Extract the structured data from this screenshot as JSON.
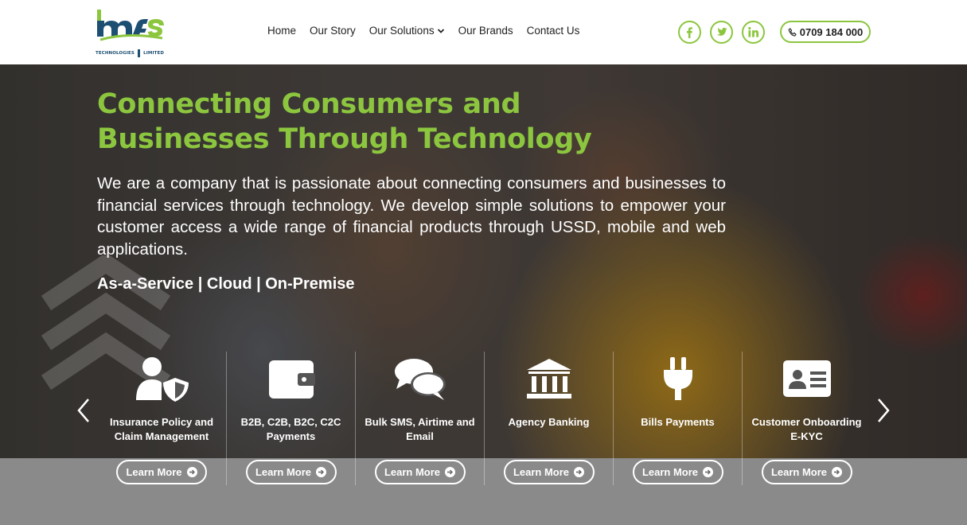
{
  "brand": {
    "logo_text": "mfs",
    "logo_subtext_1": "TECHNOLOGIES",
    "logo_subtext_2": "LIMITED",
    "accent_color": "#8cc63f",
    "dark_color": "#1d4f73"
  },
  "nav": {
    "items": [
      {
        "label": "Home"
      },
      {
        "label": "Our Story"
      },
      {
        "label": "Our Solutions",
        "has_dropdown": true
      },
      {
        "label": "Our Brands"
      },
      {
        "label": "Contact Us"
      }
    ]
  },
  "socials": [
    {
      "icon": "facebook-icon"
    },
    {
      "icon": "twitter-icon"
    },
    {
      "icon": "linkedin-icon"
    }
  ],
  "phone": {
    "icon": "phone-icon",
    "number": "0709 184 000"
  },
  "hero": {
    "title": "Connecting Consumers and Businesses Through Technology",
    "text": "We are a company that is passionate about connecting consumers and businesses to financial services through technology. We develop simple solutions to empower your customer access a wide range of financial products through USSD, mobile and web applications.",
    "tagline": "As-a-Service | Cloud | On-Premise"
  },
  "services": [
    {
      "icon": "user-shield-icon",
      "label": "Insurance Policy and Claim Management",
      "button": "Learn More"
    },
    {
      "icon": "wallet-icon",
      "label": "B2B, C2B, B2C, C2C Payments",
      "button": "Learn More"
    },
    {
      "icon": "comments-icon",
      "label": "Bulk SMS, Airtime and Email",
      "button": "Learn More"
    },
    {
      "icon": "bank-icon",
      "label": "Agency Banking",
      "button": "Learn More"
    },
    {
      "icon": "plug-icon",
      "label": "Bills Payments",
      "button": "Learn More"
    },
    {
      "icon": "id-card-icon",
      "label": "Customer Onboarding E-KYC",
      "button": "Learn More"
    }
  ]
}
